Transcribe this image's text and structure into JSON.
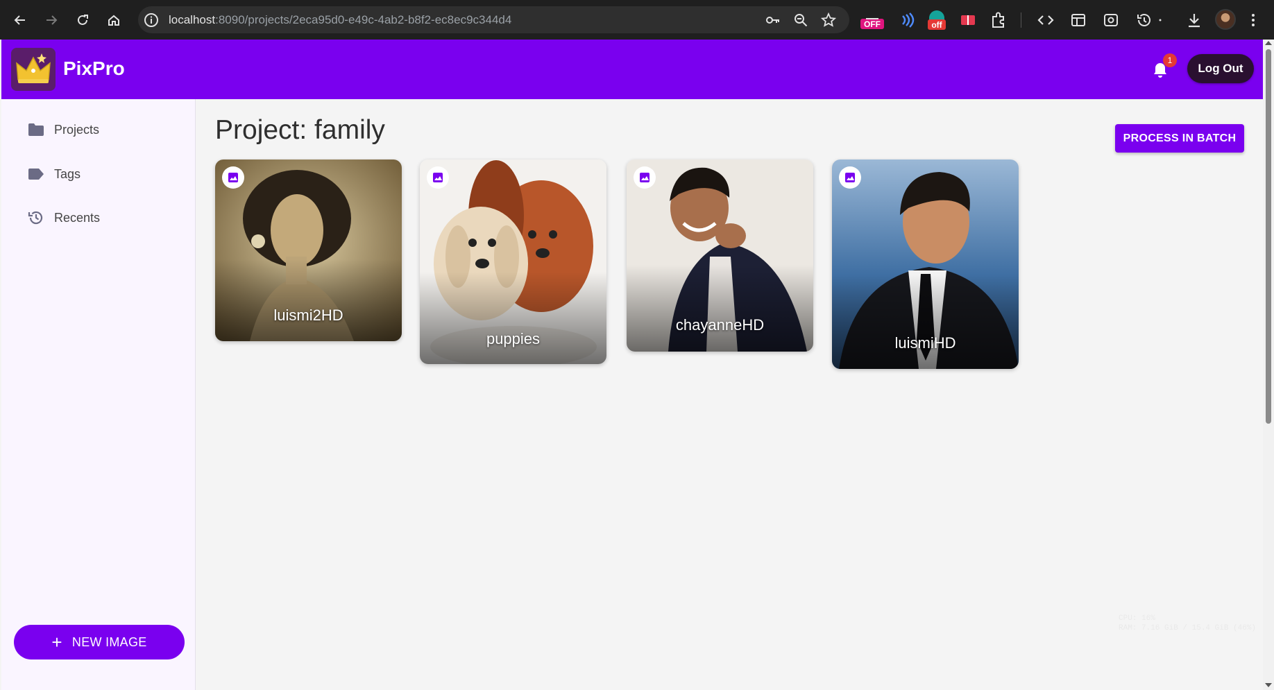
{
  "browser": {
    "url_host": "localhost",
    "url_rest": ":8090/projects/2eca95d0-e49c-4ab2-b8f2-ec8ec9c344d4",
    "extension_badge_1": "OFF",
    "extension_badge_2": "off"
  },
  "header": {
    "app_name": "PixPro",
    "notification_count": "1",
    "logout_label": "Log Out"
  },
  "sidebar": {
    "items": [
      {
        "label": "Projects",
        "icon": "folder-icon"
      },
      {
        "label": "Tags",
        "icon": "tag-icon"
      },
      {
        "label": "Recents",
        "icon": "history-icon"
      }
    ],
    "new_image_label": "NEW IMAGE"
  },
  "main": {
    "title": "Project: family",
    "batch_label": "PROCESS IN BATCH",
    "images": [
      {
        "name": "luismi2HD"
      },
      {
        "name": "puppies"
      },
      {
        "name": "chayanneHD"
      },
      {
        "name": "luismiHD"
      }
    ]
  },
  "overlay": {
    "line1": "CPU: 16%",
    "line2": "RAM: 7.16 GiB / 15.4 GiB (46%)"
  },
  "colors": {
    "brand": "#7a00ef",
    "browser_chrome": "#1f1f1f",
    "sidebar_bg": "#faf5ff",
    "logout_bg": "#2a1030",
    "badge_red": "#e53935"
  }
}
